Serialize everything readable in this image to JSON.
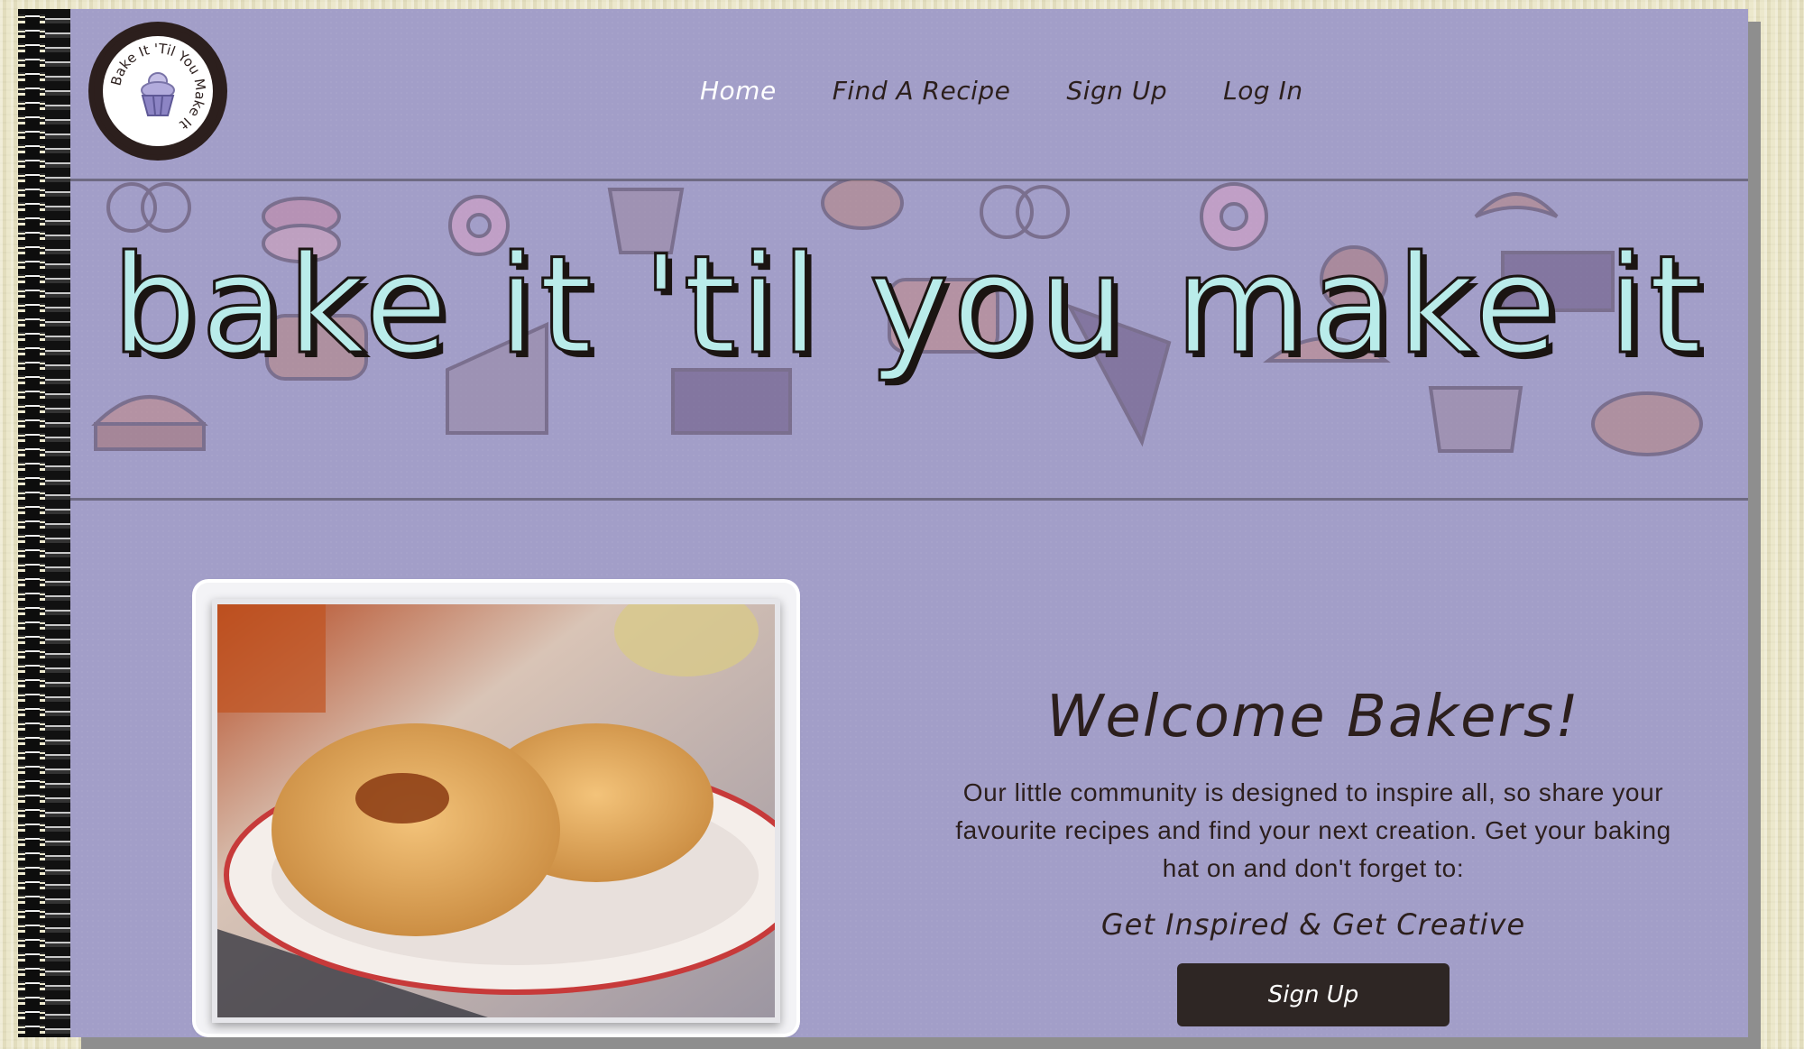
{
  "logo": {
    "text": "Bake It 'Til You Make It"
  },
  "nav": {
    "items": [
      {
        "label": "Home",
        "active": true
      },
      {
        "label": "Find A Recipe",
        "active": false
      },
      {
        "label": "Sign Up",
        "active": false
      },
      {
        "label": "Log In",
        "active": false
      }
    ]
  },
  "hero": {
    "title": "bake it 'til you make it"
  },
  "welcome": {
    "title": "Welcome Bakers!",
    "body": "Our little community is designed to inspire all, so share your favourite recipes and find your next creation. Get your baking hat on and don't forget to:",
    "tagline": "Get Inspired & Get Creative",
    "cta_label": "Sign Up"
  },
  "colors": {
    "page_purple": "#a29ec8",
    "hero_text": "#b9ecea",
    "dark_brown": "#2c1f1d",
    "button": "#2e2624"
  },
  "icons": [
    "pretzel-icon",
    "macaron-icon",
    "cupcake-icon",
    "bread-icon",
    "donut-icon",
    "pie-icon",
    "cake-slice-icon",
    "croissant-icon",
    "birthday-cake-icon",
    "cookie-icon"
  ]
}
